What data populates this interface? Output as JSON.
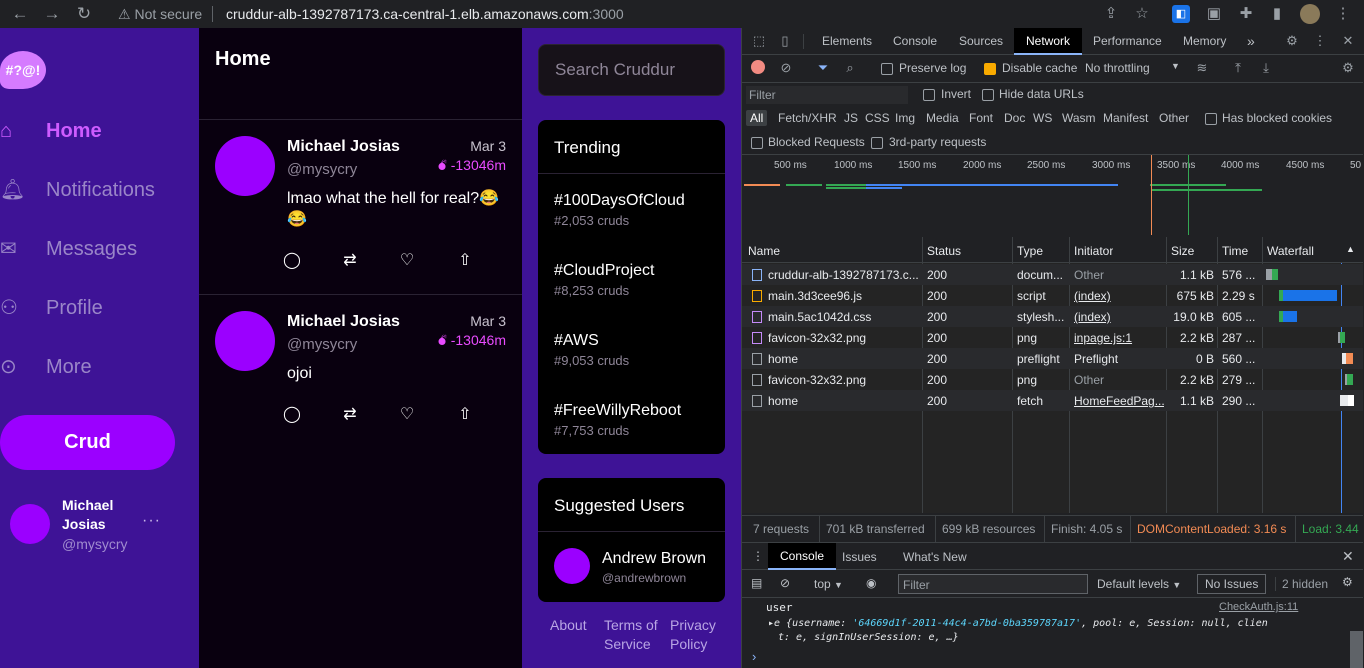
{
  "browser": {
    "not_secure": "Not secure",
    "url_host": "cruddur-alb-1392787173.ca-central-1.elb.amazonaws.com",
    "url_port": ":3000"
  },
  "sidebar": {
    "logo": "#?@!",
    "items": [
      {
        "label": "Home",
        "icon": "home-icon",
        "active": true
      },
      {
        "label": "Notifications",
        "icon": "bell-icon",
        "active": false
      },
      {
        "label": "Messages",
        "icon": "mail-icon",
        "active": false
      },
      {
        "label": "Profile",
        "icon": "user-icon",
        "active": false
      },
      {
        "label": "More",
        "icon": "more-icon",
        "active": false
      }
    ],
    "crud_label": "Crud",
    "user": {
      "name": "Michael Josias",
      "handle": "@mysycry",
      "more": "···"
    }
  },
  "feed": {
    "title": "Home",
    "posts": [
      {
        "name": "Michael Josias",
        "handle": "@mysycry",
        "date": "Mar 3",
        "expires": "-13046m",
        "text": "lmao what the hell for real?😂😂"
      },
      {
        "name": "Michael Josias",
        "handle": "@mysycry",
        "date": "Mar 3",
        "expires": "-13046m",
        "text": "ojoi"
      }
    ]
  },
  "right": {
    "search_placeholder": "Search Cruddur",
    "trending_title": "Trending",
    "trends": [
      {
        "tag": "#100DaysOfCloud",
        "count": "#2,053 cruds"
      },
      {
        "tag": "#CloudProject",
        "count": "#8,253 cruds"
      },
      {
        "tag": "#AWS",
        "count": "#9,053 cruds"
      },
      {
        "tag": "#FreeWillyReboot",
        "count": "#7,753 cruds"
      }
    ],
    "suggested_title": "Suggested Users",
    "suggested": {
      "name": "Andrew Brown",
      "handle": "@andrewbrown"
    },
    "footer": {
      "about": "About",
      "terms": "Terms of Service",
      "privacy": "Privacy Policy"
    }
  },
  "devtools": {
    "tabs": [
      "Elements",
      "Console",
      "Sources",
      "Network",
      "Performance",
      "Memory"
    ],
    "active_tab": "Network",
    "more_tabs": "»",
    "toolbar": {
      "preserve_log": "Preserve log",
      "disable_cache": "Disable cache",
      "throttling": "No throttling"
    },
    "filter": {
      "placeholder": "Filter",
      "invert": "Invert",
      "hide_data_urls": "Hide data URLs"
    },
    "types": [
      "All",
      "Fetch/XHR",
      "JS",
      "CSS",
      "Img",
      "Media",
      "Font",
      "Doc",
      "WS",
      "Wasm",
      "Manifest",
      "Other"
    ],
    "has_blocked_cookies": "Has blocked cookies",
    "blocked_requests": "Blocked Requests",
    "third_party": "3rd-party requests",
    "timeline_ticks": [
      "500 ms",
      "1000 ms",
      "1500 ms",
      "2000 ms",
      "2500 ms",
      "3000 ms",
      "3500 ms",
      "4000 ms",
      "4500 ms",
      "50"
    ],
    "columns": [
      "Name",
      "Status",
      "Type",
      "Initiator",
      "Size",
      "Time",
      "Waterfall"
    ],
    "requests": [
      {
        "name": "cruddur-alb-1392787173.c...",
        "status": "200",
        "type": "docum...",
        "initiator": "Other",
        "size": "1.1 kB",
        "time": "576 ...",
        "initiator_link": false
      },
      {
        "name": "main.3d3cee96.js",
        "status": "200",
        "type": "script",
        "initiator": "(index)",
        "size": "675 kB",
        "time": "2.29 s",
        "initiator_link": true
      },
      {
        "name": "main.5ac1042d.css",
        "status": "200",
        "type": "stylesh...",
        "initiator": "(index)",
        "size": "19.0 kB",
        "time": "605 ...",
        "initiator_link": true
      },
      {
        "name": "favicon-32x32.png",
        "status": "200",
        "type": "png",
        "initiator": "inpage.js:1",
        "size": "2.2 kB",
        "time": "287 ...",
        "initiator_link": true
      },
      {
        "name": "home",
        "status": "200",
        "type": "preflight",
        "initiator": "Preflight",
        "size": "0 B",
        "time": "560 ...",
        "initiator_link": false
      },
      {
        "name": "favicon-32x32.png",
        "status": "200",
        "type": "png",
        "initiator": "Other",
        "size": "2.2 kB",
        "time": "279 ...",
        "initiator_link": false
      },
      {
        "name": "home",
        "status": "200",
        "type": "fetch",
        "initiator": "HomeFeedPag...",
        "size": "1.1 kB",
        "time": "290 ...",
        "initiator_link": true
      }
    ],
    "summary": {
      "requests": "7 requests",
      "transferred": "701 kB transferred",
      "resources": "699 kB resources",
      "finish": "Finish: 4.05 s",
      "dcl": "DOMContentLoaded: 3.16 s",
      "load": "Load: 3.44"
    },
    "console": {
      "tabs": [
        "Console",
        "Issues",
        "What's New"
      ],
      "context": "top",
      "filter_placeholder": "Filter",
      "levels": "Default levels",
      "issues": "No Issues",
      "hidden": "2 hidden",
      "log_label": "user",
      "log_source": "CheckAuth.js:11",
      "log_obj_1": "e {username: ",
      "log_uuid": "'64669d1f-2011-44c4-a7bd-0ba359787a17'",
      "log_obj_2": ", pool: e, Session: null, clien",
      "log_obj_3": "t: e, signInUserSession: e, …}",
      "prompt": "›"
    },
    "colors": {
      "dcl": "#f28b54",
      "load": "#34a853",
      "accent": "#8ab4f8"
    }
  }
}
